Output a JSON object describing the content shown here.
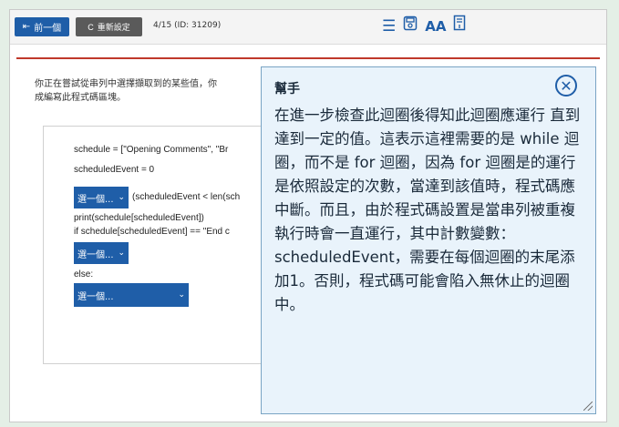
{
  "toolbar": {
    "prev_label": "前一個",
    "reset_label": "重新設定",
    "progress": "4/15 (ID: 31209)",
    "icons": [
      "list-icon",
      "save-icon",
      "text-size-icon",
      "reader-icon"
    ]
  },
  "question": {
    "text": "你正在嘗試從串列中選擇擷取到的某些值，你\n成編寫此程式碼區塊。"
  },
  "code": {
    "line1": "schedule = [\"Opening Comments\", \"Br",
    "line2": "scheduledEvent = 0",
    "dropdown1": "選一個...",
    "line3_rest": "(scheduledEvent < len(sch",
    "line4": "print(schedule[scheduledEvent])",
    "line5": "if schedule[scheduledEvent] == \"End c",
    "dropdown2": "選一個...",
    "line6": "else:",
    "dropdown3": "選一個..."
  },
  "helper": {
    "title": "幫手",
    "body": "在進一步檢查此迴圈後得知此迴圈應運行 直到達到一定的值。這表示這裡需要的是 while 迴圈，而不是 for 迴圈，因為 for 迴圈是的運行是依照設定的次數，當達到該值時，程式碼應中斷。而且，由於程式碼設置是當串列被重複執行時會一直運行，其中計數變數：scheduledEvent，需要在每個迴圈的末尾添加1。否則，程式碼可能會陷入無休止的迴圈中。"
  },
  "colors": {
    "primary": "#1f5ea8",
    "helper_bg": "#e9f3fb",
    "accent_red": "#c0392b"
  }
}
